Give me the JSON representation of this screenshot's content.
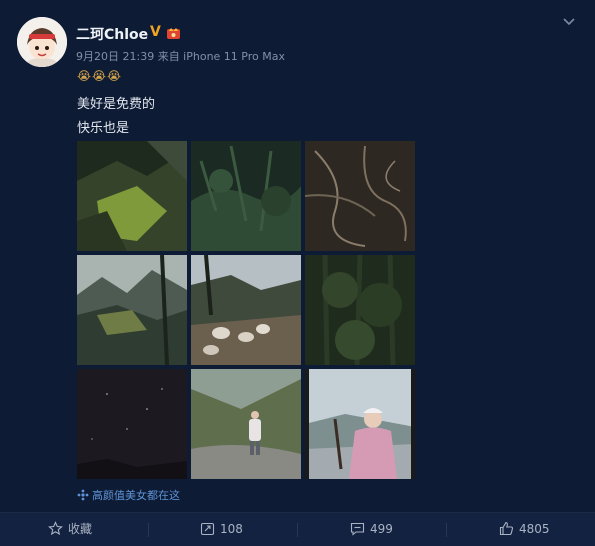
{
  "post": {
    "username": "二珂Chloe",
    "verified_badge": "V",
    "meta": "9月20日 21:39 来自 iPhone 11 Pro Max",
    "emoji_line": "😭😭😭",
    "text_line1": "美好是免费的",
    "text_line2": "快乐也是",
    "topic": "高颜值美女都在这"
  },
  "photos": [
    {
      "name": "photo-mountain-sunlight"
    },
    {
      "name": "photo-forest-undergrowth"
    },
    {
      "name": "photo-tree-roots"
    },
    {
      "name": "photo-mountain-valley"
    },
    {
      "name": "photo-goats-on-path"
    },
    {
      "name": "photo-dark-forest"
    },
    {
      "name": "photo-night-sky"
    },
    {
      "name": "photo-person-on-rock"
    },
    {
      "name": "photo-person-pink-jacket"
    }
  ],
  "actions": {
    "favorite_label": "收藏",
    "repost_count": "108",
    "comment_count": "499",
    "like_count": "4805"
  },
  "colors": {
    "background": "#0e1b35",
    "action_bar": "#132241",
    "link": "#5d93d6",
    "badge": "#f2a421"
  }
}
